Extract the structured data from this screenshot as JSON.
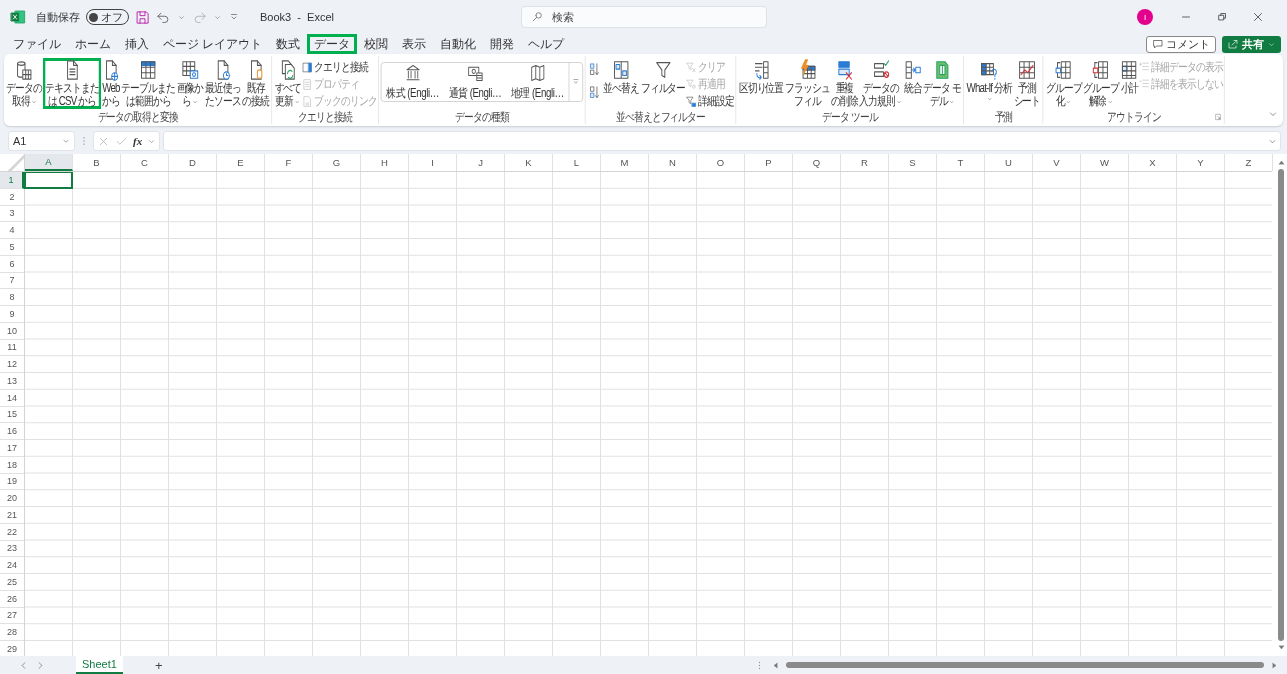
{
  "title_bar": {
    "autosave_label": "自動保存",
    "autosave": {
      "label": "オフ",
      "on": false
    },
    "document_title": "Book3  -  Excel",
    "search": {
      "placeholder": "検索"
    },
    "account_initial": "I"
  },
  "tabs": [
    {
      "label": "ファイル",
      "selected": false
    },
    {
      "label": "ホーム",
      "selected": false
    },
    {
      "label": "挿入",
      "selected": false
    },
    {
      "label": "ページ レイアウト",
      "selected": false
    },
    {
      "label": "数式",
      "selected": false
    },
    {
      "label": "データ",
      "selected": true
    },
    {
      "label": "校閲",
      "selected": false
    },
    {
      "label": "表示",
      "selected": false
    },
    {
      "label": "自動化",
      "selected": false
    },
    {
      "label": "開発",
      "selected": false
    },
    {
      "label": "ヘルプ",
      "selected": false
    }
  ],
  "comment_button": "コメント",
  "share_button": "共有",
  "ribbon": {
    "groups": [
      {
        "label": "データの取得と変換",
        "columns": [
          {
            "kind": "large",
            "lines": [
              "データの",
              "取得"
            ],
            "dropdown": true,
            "highlighted": false
          },
          {
            "kind": "large",
            "lines": [
              "テキストまた",
              "は CSV から"
            ],
            "dropdown": false,
            "highlighted": true
          },
          {
            "kind": "large",
            "lines": [
              "Web",
              "から"
            ],
            "dropdown": false,
            "highlighted": false
          },
          {
            "kind": "large",
            "lines": [
              "テーブルまた",
              "は範囲から"
            ],
            "dropdown": false,
            "highlighted": false
          },
          {
            "kind": "large",
            "lines": [
              "画像か",
              "ら"
            ],
            "dropdown": true,
            "highlighted": false
          },
          {
            "kind": "large",
            "lines": [
              "最近使っ",
              "たソース"
            ],
            "dropdown": false,
            "highlighted": false
          },
          {
            "kind": "large",
            "lines": [
              "既存",
              "の接続"
            ],
            "dropdown": false,
            "highlighted": false
          }
        ]
      },
      {
        "label": "クエリと接続",
        "columns": [
          {
            "kind": "large",
            "lines": [
              "すべて",
              "更新"
            ],
            "dropdown": true,
            "highlighted": false
          },
          {
            "kind": "stack",
            "items": [
              {
                "label": "クエリと接続",
                "disabled": false
              },
              {
                "label": "プロパティ",
                "disabled": true
              },
              {
                "label": "ブックのリンク",
                "disabled": true
              }
            ]
          }
        ]
      },
      {
        "label": "データの種類",
        "columns": [
          {
            "kind": "gallery",
            "items": [
              {
                "label": "株式 (Engli…"
              },
              {
                "label": "通貨 (Engli…"
              },
              {
                "label": "地理 (Engli…"
              }
            ]
          }
        ]
      },
      {
        "label": "並べ替えとフィルター",
        "columns": [
          {
            "kind": "sort"
          },
          {
            "kind": "large",
            "lines": [
              "並べ替え"
            ],
            "dropdown": false,
            "highlighted": false
          },
          {
            "kind": "large",
            "lines": [
              "フィルター"
            ],
            "dropdown": false,
            "highlighted": false
          },
          {
            "kind": "stack",
            "items": [
              {
                "label": "クリア",
                "disabled": true
              },
              {
                "label": "再適用",
                "disabled": true
              },
              {
                "label": "詳細設定",
                "disabled": false
              }
            ]
          }
        ]
      },
      {
        "label": "データ ツール",
        "columns": [
          {
            "kind": "large",
            "lines": [
              "区切り位置"
            ],
            "dropdown": false,
            "highlighted": false
          },
          {
            "kind": "large",
            "lines": [
              "フラッシュ",
              "フィル"
            ],
            "dropdown": false,
            "highlighted": false
          },
          {
            "kind": "large",
            "lines": [
              "重複",
              "の削除"
            ],
            "dropdown": false,
            "highlighted": false
          },
          {
            "kind": "large",
            "lines": [
              "データの",
              "入力規則"
            ],
            "dropdown": true,
            "highlighted": false
          },
          {
            "kind": "large",
            "lines": [
              "統合"
            ],
            "dropdown": false,
            "highlighted": false
          },
          {
            "kind": "large",
            "lines": [
              "データ モ",
              "デル"
            ],
            "dropdown": true,
            "highlighted": false
          }
        ]
      },
      {
        "label": "予測",
        "columns": [
          {
            "kind": "large",
            "lines": [
              "What-If 分析"
            ],
            "dropdown": true,
            "highlighted": false
          },
          {
            "kind": "large",
            "lines": [
              "予測",
              "シート"
            ],
            "dropdown": false,
            "highlighted": false
          }
        ]
      },
      {
        "label": "アウトライン",
        "columns": [
          {
            "kind": "large",
            "lines": [
              "グループ",
              "化"
            ],
            "dropdown": true,
            "highlighted": false
          },
          {
            "kind": "large",
            "lines": [
              "グループ",
              "解除"
            ],
            "dropdown": true,
            "highlighted": false
          },
          {
            "kind": "large",
            "lines": [
              "小計"
            ],
            "dropdown": false,
            "highlighted": false
          },
          {
            "kind": "stack",
            "items": [
              {
                "label": "詳細データの表示",
                "disabled": true
              },
              {
                "label": "詳細を表示しない",
                "disabled": true
              }
            ]
          }
        ]
      }
    ]
  },
  "formula_bar": {
    "name_box": "A1",
    "function_label": "fx"
  },
  "sheet": {
    "columns": [
      {
        "label": "A",
        "selected": true
      },
      {
        "label": "B",
        "selected": false
      },
      {
        "label": "C",
        "selected": false
      },
      {
        "label": "D",
        "selected": false
      },
      {
        "label": "E",
        "selected": false
      },
      {
        "label": "F",
        "selected": false
      },
      {
        "label": "G",
        "selected": false
      },
      {
        "label": "H",
        "selected": false
      },
      {
        "label": "I",
        "selected": false
      },
      {
        "label": "J",
        "selected": false
      },
      {
        "label": "K",
        "selected": false
      },
      {
        "label": "L",
        "selected": false
      },
      {
        "label": "M",
        "selected": false
      },
      {
        "label": "N",
        "selected": false
      },
      {
        "label": "O",
        "selected": false
      },
      {
        "label": "P",
        "selected": false
      },
      {
        "label": "Q",
        "selected": false
      },
      {
        "label": "R",
        "selected": false
      },
      {
        "label": "S",
        "selected": false
      },
      {
        "label": "T",
        "selected": false
      },
      {
        "label": "U",
        "selected": false
      },
      {
        "label": "V",
        "selected": false
      },
      {
        "label": "W",
        "selected": false
      },
      {
        "label": "X",
        "selected": false
      },
      {
        "label": "Y",
        "selected": false
      },
      {
        "label": "Z",
        "selected": false
      }
    ],
    "rows": [
      {
        "label": "1",
        "selected": true
      },
      {
        "label": "2",
        "selected": false
      },
      {
        "label": "3",
        "selected": false
      },
      {
        "label": "4",
        "selected": false
      },
      {
        "label": "5",
        "selected": false
      },
      {
        "label": "6",
        "selected": false
      },
      {
        "label": "7",
        "selected": false
      },
      {
        "label": "8",
        "selected": false
      },
      {
        "label": "9",
        "selected": false
      },
      {
        "label": "10",
        "selected": false
      },
      {
        "label": "11",
        "selected": false
      },
      {
        "label": "12",
        "selected": false
      },
      {
        "label": "13",
        "selected": false
      },
      {
        "label": "14",
        "selected": false
      },
      {
        "label": "15",
        "selected": false
      },
      {
        "label": "16",
        "selected": false
      },
      {
        "label": "17",
        "selected": false
      },
      {
        "label": "18",
        "selected": false
      },
      {
        "label": "19",
        "selected": false
      },
      {
        "label": "20",
        "selected": false
      },
      {
        "label": "21",
        "selected": false
      },
      {
        "label": "22",
        "selected": false
      },
      {
        "label": "23",
        "selected": false
      },
      {
        "label": "24",
        "selected": false
      },
      {
        "label": "25",
        "selected": false
      },
      {
        "label": "26",
        "selected": false
      },
      {
        "label": "27",
        "selected": false
      },
      {
        "label": "28",
        "selected": false
      },
      {
        "label": "29",
        "selected": false
      }
    ]
  },
  "sheet_tabs": [
    {
      "label": "Sheet1",
      "selected": true
    }
  ],
  "add_sheet_button": "+"
}
